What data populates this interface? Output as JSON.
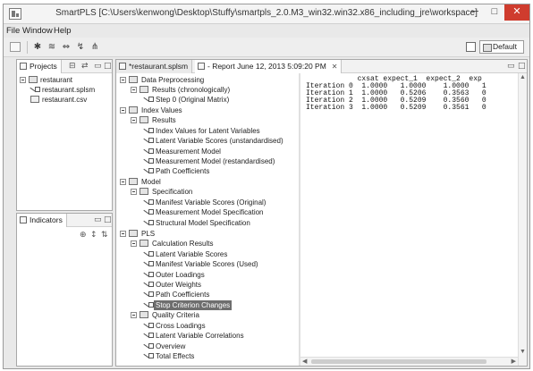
{
  "window": {
    "title": "SmartPLS [C:\\Users\\kenwong\\Desktop\\Stuffy\\smartpls_2.0.M3_win32.win32.x86_including_jre\\workspace]",
    "minimize": "─",
    "maximize": "□",
    "close": "✕"
  },
  "menu": [
    "File",
    "Window",
    "Help"
  ],
  "toolbar": {
    "perspective_label": "Default"
  },
  "projects_panel": {
    "tab_label": "Projects",
    "tree": {
      "root": "restaurant",
      "files": [
        "restaurant.splsm",
        "restaurant.csv"
      ]
    }
  },
  "indicators_panel": {
    "tab_label": "Indicators"
  },
  "editor": {
    "tabs": [
      {
        "label": "*restaurant.splsm"
      },
      {
        "label": "- Report June 12, 2013 5:09:20 PM"
      }
    ]
  },
  "report_tree": {
    "data_preprocessing": {
      "label": "Data Preprocessing",
      "results_label": "Results (chronologically)",
      "step0": "Step 0 (Original Matrix)"
    },
    "index_values": {
      "label": "Index Values",
      "results_label": "Results",
      "items": [
        "Index Values for Latent Variables",
        "Latent Variable Scores (unstandardised)",
        "Measurement Model",
        "Measurement Model (restandardised)",
        "Path Coefficients"
      ]
    },
    "model": {
      "label": "Model",
      "spec_label": "Specification",
      "items": [
        "Manifest Variable Scores (Original)",
        "Measurement Model Specification",
        "Structural Model Specification"
      ]
    },
    "pls": {
      "label": "PLS",
      "calc_label": "Calculation Results",
      "calc_items": [
        "Latent Variable Scores",
        "Manifest Variable Scores (Used)",
        "Outer Loadings",
        "Outer Weights",
        "Path Coefficients",
        "Stop Criterion Changes"
      ],
      "quality_label": "Quality Criteria",
      "quality_items": [
        "Cross Loadings",
        "Latent Variable Correlations",
        "Overview",
        "Total Effects"
      ]
    }
  },
  "report": {
    "header": "            cxsat expect_1  expect_2  exp",
    "rows": [
      "Iteration 0  1.0000   1.0000    1.0000   1",
      "Iteration 1  1.0000   0.5206    0.3563   0",
      "Iteration 2  1.0000   0.5209    0.3560   0",
      "Iteration 3  1.0000   0.5209    0.3561   0"
    ]
  }
}
